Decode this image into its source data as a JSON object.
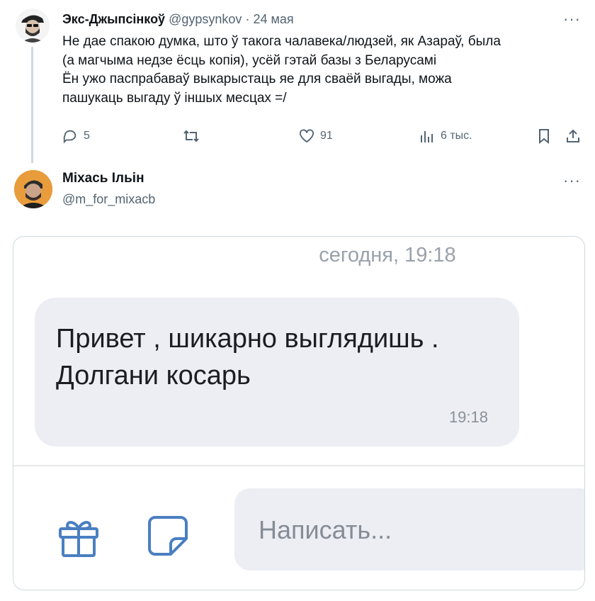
{
  "tweet1": {
    "name": "Экс-Джыпсінкоў",
    "handle": "@gypsynkov",
    "separator": "·",
    "date": "24 мая",
    "more": "···",
    "lines": [
      "Не дае спакою думка, што ў такога чалавека/людзей, як Азараў, была",
      "(а магчыма недзе ёсць копія), усёй гэтай базы з Беларусамі",
      "Ён ужо паспрабаваў выкарыстаць яе для сваёй выгады, можа",
      "пашукаць выгаду ў іншых месцах =/"
    ],
    "actions": {
      "replies": "5",
      "retweets": "",
      "likes": "91",
      "views": "6 тыс."
    }
  },
  "tweet2": {
    "name": "Міхась Ільін",
    "handle": "@m_for_mixacb",
    "more": "···"
  },
  "chat": {
    "date_label": "сегодня, 19:18",
    "message_lines": [
      "Привет , шикарно выглядишь .",
      "Долгани косарь"
    ],
    "message_time": "19:18",
    "input_placeholder": "Написать..."
  },
  "colors": {
    "accent": "#4a7fc1",
    "bubble": "#eceef3",
    "muted": "#536471"
  }
}
